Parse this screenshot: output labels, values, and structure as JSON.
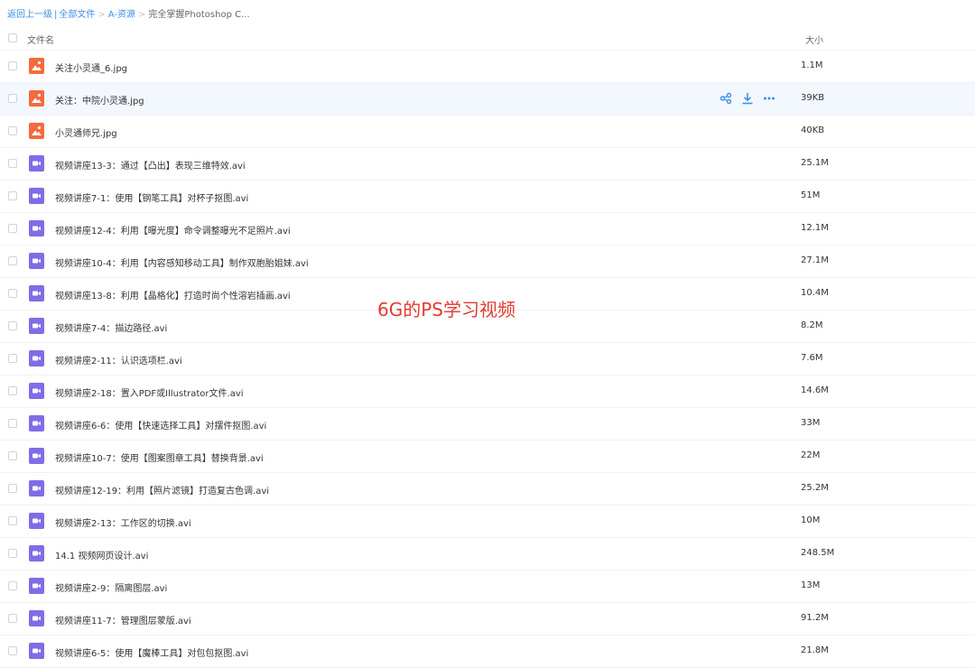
{
  "breadcrumb": {
    "back": "返回上一级",
    "all": "全部文件",
    "folder": "A-资源",
    "current": "完全掌握Photoshop C..."
  },
  "header": {
    "name": "文件名",
    "size": "大小"
  },
  "colors": {
    "image_icon": "#f46b3c",
    "video_icon": "#7f6de8",
    "link": "#3d8ee8",
    "overlay": "#e53a2e"
  },
  "hover_actions": [
    "share-icon",
    "download-icon",
    "more-icon"
  ],
  "files": [
    {
      "name": "关注小灵通_6.jpg",
      "size": "1.1M",
      "type": "image"
    },
    {
      "name": "关注：中院小灵通.jpg",
      "size": "39KB",
      "type": "image",
      "hover": true
    },
    {
      "name": "小灵通师兄.jpg",
      "size": "40KB",
      "type": "image"
    },
    {
      "name": "视频讲座13-3：通过【凸出】表现三维特效.avi",
      "size": "25.1M",
      "type": "video"
    },
    {
      "name": "视频讲座7-1：使用【钢笔工具】对杯子抠图.avi",
      "size": "51M",
      "type": "video"
    },
    {
      "name": "视频讲座12-4：利用【曝光度】命令调整曝光不足照片.avi",
      "size": "12.1M",
      "type": "video"
    },
    {
      "name": "视频讲座10-4：利用【内容感知移动工具】制作双胞胎姐妹.avi",
      "size": "27.1M",
      "type": "video"
    },
    {
      "name": "视频讲座13-8：利用【晶格化】打造时尚个性溶岩插画.avi",
      "size": "10.4M",
      "type": "video"
    },
    {
      "name": "视频讲座7-4：描边路径.avi",
      "size": "8.2M",
      "type": "video"
    },
    {
      "name": "视频讲座2-11：认识选项栏.avi",
      "size": "7.6M",
      "type": "video"
    },
    {
      "name": "视频讲座2-18：置入PDF或Illustrator文件.avi",
      "size": "14.6M",
      "type": "video"
    },
    {
      "name": "视频讲座6-6：使用【快速选择工具】对摆件抠图.avi",
      "size": "33M",
      "type": "video"
    },
    {
      "name": "视频讲座10-7：使用【图案图章工具】替换背景.avi",
      "size": "22M",
      "type": "video"
    },
    {
      "name": "视频讲座12-19：利用【照片滤镜】打造复古色调.avi",
      "size": "25.2M",
      "type": "video"
    },
    {
      "name": "视频讲座2-13：工作区的切换.avi",
      "size": "10M",
      "type": "video"
    },
    {
      "name": "14.1 视频网页设计.avi",
      "size": "248.5M",
      "type": "video"
    },
    {
      "name": "视频讲座2-9：隔离图层.avi",
      "size": "13M",
      "type": "video"
    },
    {
      "name": "视频讲座11-7：管理图层蒙版.avi",
      "size": "91.2M",
      "type": "video"
    },
    {
      "name": "视频讲座6-5：使用【魔棒工具】对包包抠图.avi",
      "size": "21.8M",
      "type": "video"
    }
  ],
  "overlay_text": "6G的PS学习视频"
}
